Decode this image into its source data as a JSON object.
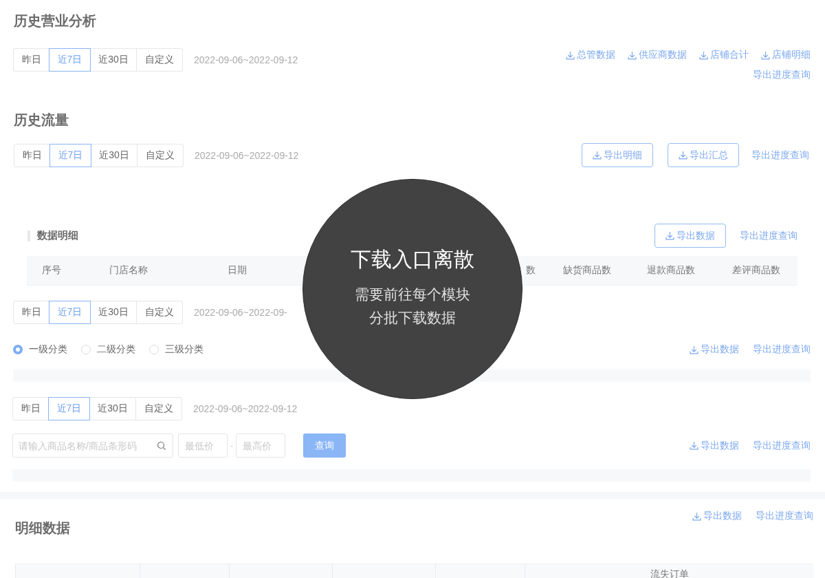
{
  "business_analysis": {
    "title": "历史营业分析",
    "range_tabs": [
      {
        "label": "昨日",
        "selected": false
      },
      {
        "label": "近7日",
        "selected": true
      },
      {
        "label": "近30日",
        "selected": false
      },
      {
        "label": "自定义",
        "selected": false
      }
    ],
    "date_range": "2022-09-06~2022-09-12",
    "exports": [
      "总管数据",
      "供应商数据",
      "店铺合计",
      "店铺明细"
    ],
    "progress_link": "导出进度查询"
  },
  "traffic": {
    "title": "历史流量",
    "range_tabs": [
      {
        "label": "昨日",
        "selected": false
      },
      {
        "label": "近7日",
        "selected": true
      },
      {
        "label": "近30日",
        "selected": false
      },
      {
        "label": "自定义",
        "selected": false
      }
    ],
    "date_range": "2022-09-06~2022-09-12",
    "export_buttons": [
      "导出明细",
      "导出汇总"
    ],
    "progress_link": "导出进度查询"
  },
  "data_detail": {
    "title": "数据明细",
    "export_button": "导出数据",
    "progress_link": "导出进度查询",
    "columns": [
      "序号",
      "门店名称",
      "日期",
      "数",
      "缺货商品数",
      "退款商品数",
      "差评商品数"
    ]
  },
  "category_ranking": {
    "range_tabs": [
      {
        "label": "昨日",
        "selected": false
      },
      {
        "label": "近7日",
        "selected": true
      },
      {
        "label": "近30日",
        "selected": false
      },
      {
        "label": "自定义",
        "selected": false
      }
    ],
    "date_range": "2022-09-06~2022-09-",
    "levels": [
      {
        "label": "一级分类",
        "selected": true
      },
      {
        "label": "二级分类",
        "selected": false
      },
      {
        "label": "三级分类",
        "selected": false
      }
    ],
    "export_link": "导出数据",
    "progress_link": "导出进度查询"
  },
  "product_ranking": {
    "range_tabs": [
      {
        "label": "昨日",
        "selected": false
      },
      {
        "label": "近7日",
        "selected": true
      },
      {
        "label": "近30日",
        "selected": false
      },
      {
        "label": "自定义",
        "selected": false
      }
    ],
    "date_range": "2022-09-06~2022-09-12",
    "search": {
      "placeholder": "请输入商品名称/商品条形码"
    },
    "min_price": {
      "placeholder": "最低价"
    },
    "separator": "-",
    "max_price": {
      "placeholder": "最高价"
    },
    "query_button": "查询",
    "export_link": "导出数据",
    "progress_link": "导出进度查询"
  },
  "detail_data": {
    "title": "明细数据",
    "export_link": "导出数据",
    "progress_link": "导出进度查询",
    "group_header": "流失订单"
  },
  "callout": {
    "title": "下载入口离散",
    "lines": [
      "需要前往每个模块",
      "分批下载数据"
    ]
  }
}
